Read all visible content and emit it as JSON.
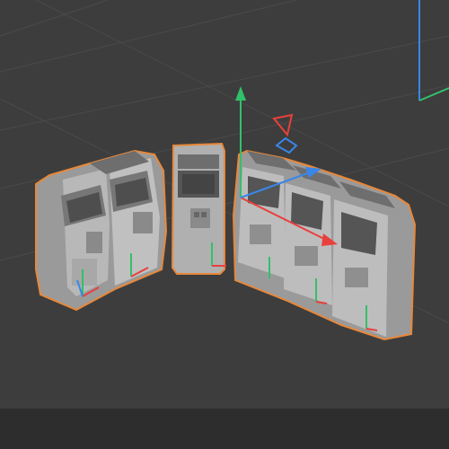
{
  "viewport": {
    "theme": {
      "background": "#3d3d3d",
      "grid_line": "#484848",
      "selection_outline": "#e8883a",
      "cabinet_face": "#b8b8b8",
      "cabinet_side": "#8e8e8e",
      "cabinet_dark": "#6e6e6e",
      "axis_x": "#e8403c",
      "axis_y": "#33c06a",
      "axis_z": "#3a86e8",
      "bottom_bar": "#2d2d2d"
    },
    "gizmo_icons": [
      "move-arrow-x-icon",
      "move-arrow-y-icon",
      "move-arrow-z-icon",
      "plane-handle-icon"
    ],
    "object_count": 7
  }
}
